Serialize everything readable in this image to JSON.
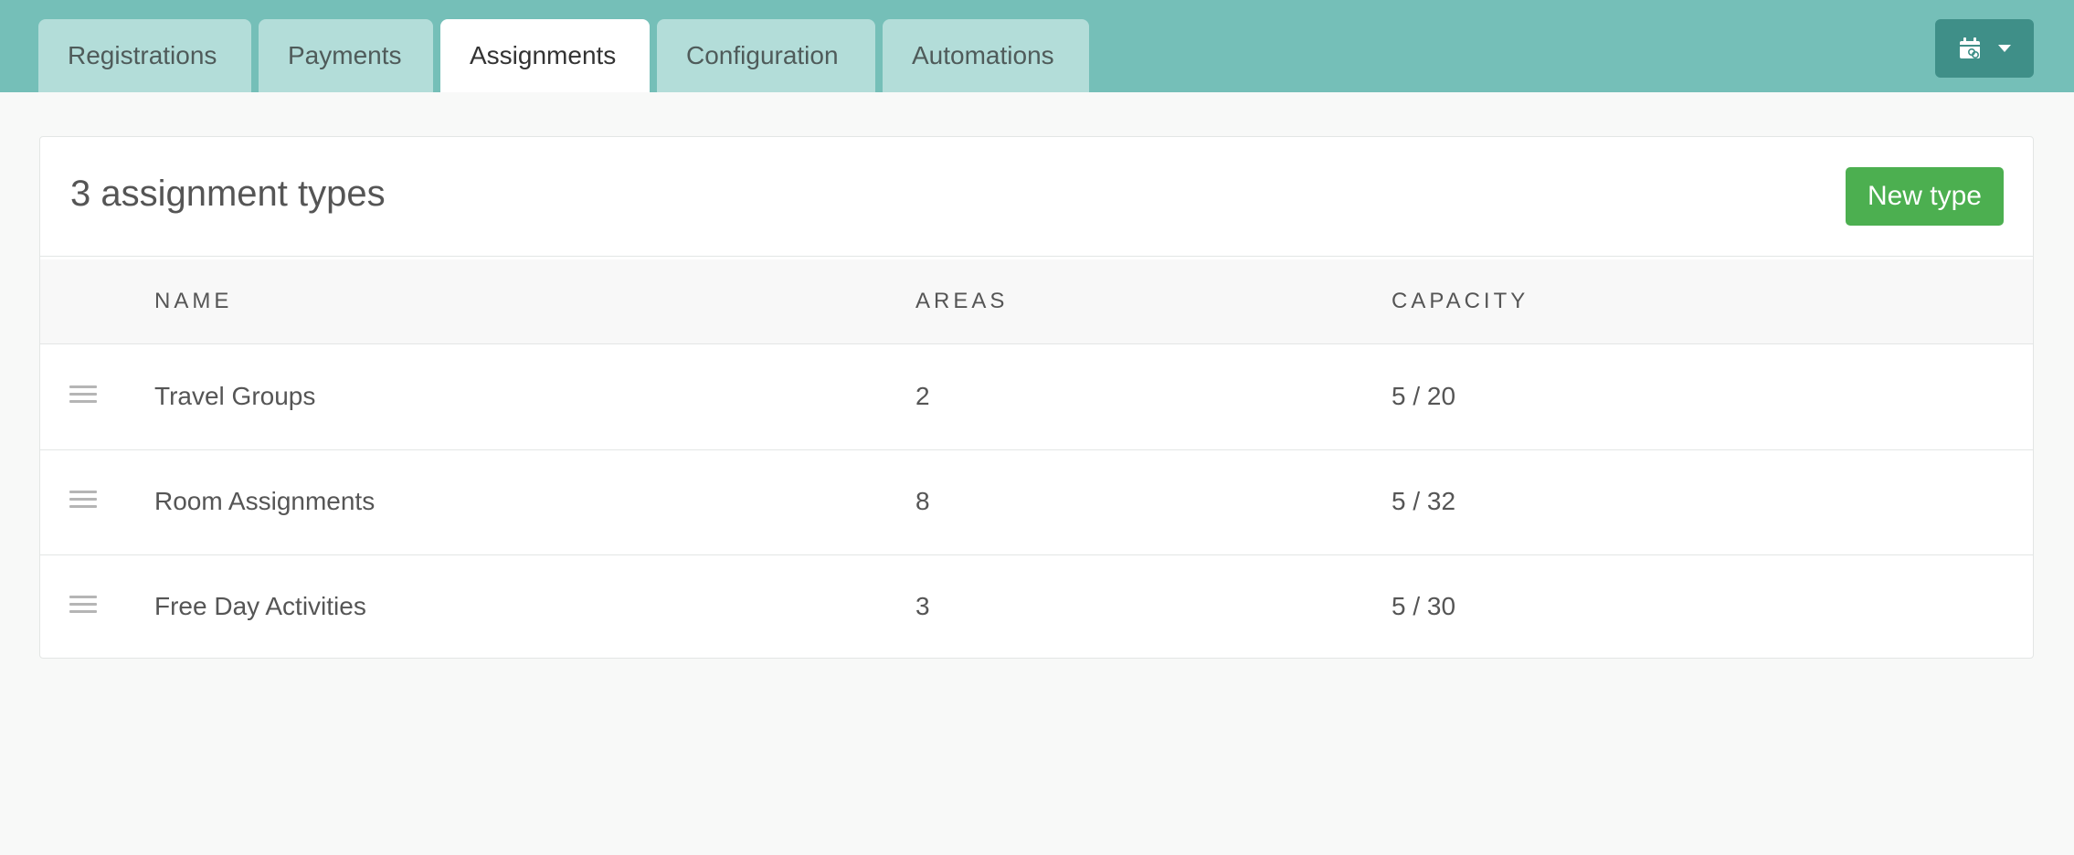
{
  "tabs": [
    {
      "label": "Registrations",
      "active": false
    },
    {
      "label": "Payments",
      "active": false
    },
    {
      "label": "Assignments",
      "active": true
    },
    {
      "label": "Configuration",
      "active": false
    },
    {
      "label": "Automations",
      "active": false
    }
  ],
  "toolbar": {
    "calendar_icon": "calendar-link-icon",
    "dropdown_icon": "caret-down-icon"
  },
  "card": {
    "title": "3 assignment types",
    "new_button_label": "New type"
  },
  "table": {
    "columns": [
      "NAME",
      "AREAS",
      "CAPACITY"
    ],
    "rows": [
      {
        "name": "Travel Groups",
        "areas": "2",
        "capacity": "5 / 20"
      },
      {
        "name": "Room Assignments",
        "areas": "8",
        "capacity": "5 / 32"
      },
      {
        "name": "Free Day Activities",
        "areas": "3",
        "capacity": "5 / 30"
      }
    ]
  },
  "colors": {
    "topbar": "#75bfb8",
    "tab_inactive": "#b3ddd9",
    "primary_button": "#4caf50",
    "calendar_button": "#3f8f88"
  }
}
